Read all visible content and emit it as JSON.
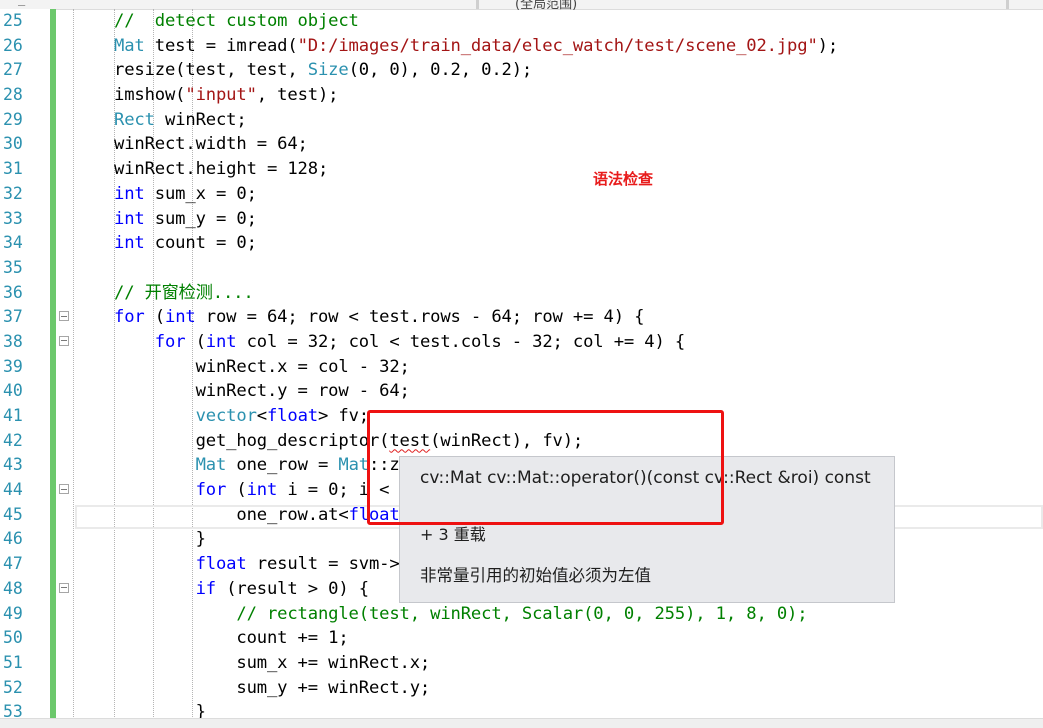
{
  "editor": {
    "lines": [
      {
        "num": "25",
        "html": "<span class=\"c\">//  detect custom object</span>"
      },
      {
        "num": "26",
        "html": "<span class=\"t\">Mat</span> test = imread(<span class=\"s\">\"D:/images/train_data/elec_watch/test/scene_02.jpg\"</span>);"
      },
      {
        "num": "27",
        "html": "resize(test, test, <span class=\"t\">Size</span>(0, 0), 0.2, 0.2);"
      },
      {
        "num": "28",
        "html": "imshow(<span class=\"s\">\"input\"</span>, test);"
      },
      {
        "num": "29",
        "html": "<span class=\"t\">Rect</span> winRect;"
      },
      {
        "num": "30",
        "html": "winRect.width = 64;"
      },
      {
        "num": "31",
        "html": "winRect.height = 128;"
      },
      {
        "num": "32",
        "html": "<span class=\"k\">int</span> sum_x = 0;"
      },
      {
        "num": "33",
        "html": "<span class=\"k\">int</span> sum_y = 0;"
      },
      {
        "num": "34",
        "html": "<span class=\"k\">int</span> count = 0;"
      },
      {
        "num": "35",
        "html": ""
      },
      {
        "num": "36",
        "html": "<span class=\"c\">// 开窗检测....</span>"
      },
      {
        "num": "37",
        "html": "<span class=\"k\">for</span> (<span class=\"k\">int</span> row = 64; row &lt; test.rows - 64; row += 4) {",
        "fold": true
      },
      {
        "num": "38",
        "html": "    <span class=\"k\">for</span> (<span class=\"k\">int</span> col = 32; col &lt; test.cols - 32; col += 4) {",
        "fold": true
      },
      {
        "num": "39",
        "html": "        winRect.x = col - 32;"
      },
      {
        "num": "40",
        "html": "        winRect.y = row - 64;"
      },
      {
        "num": "41",
        "html": "        <span class=\"t\">vector</span>&lt;<span class=\"k\">float</span>&gt; fv;"
      },
      {
        "num": "42",
        "html": "        get_hog_descriptor(<span class=\"squig\">test</span>(winRect), fv);"
      },
      {
        "num": "43",
        "html": "        <span class=\"t\">Mat</span> one_row = <span class=\"t\">Mat</span>::zeros"
      },
      {
        "num": "44",
        "html": "        <span class=\"k\">for</span> (<span class=\"k\">int</span> i = 0; i &lt; fv.",
        "fold": true
      },
      {
        "num": "45",
        "html": "            one_row.at&lt;<span class=\"k\">float</span>&gt;(0"
      },
      {
        "num": "46",
        "html": "        }"
      },
      {
        "num": "47",
        "html": "        <span class=\"k\">float</span> result = svm-&gt;pr"
      },
      {
        "num": "48",
        "html": "        <span class=\"k\">if</span> (result &gt; 0) {",
        "fold": true
      },
      {
        "num": "49",
        "html": "            <span class=\"c\">// rectangle(test, winRect, Scalar(0, 0, 255), 1, 8, 0);</span>"
      },
      {
        "num": "50",
        "html": "            count += 1;"
      },
      {
        "num": "51",
        "html": "            sum_x += winRect.x;"
      },
      {
        "num": "52",
        "html": "            sum_y += winRect.y;"
      },
      {
        "num": "53",
        "html": "        }"
      }
    ]
  },
  "annotation": {
    "label": "语法检查",
    "color": "#e81c1c"
  },
  "tooltip": {
    "signature": "cv::Mat cv::Mat::operator()(const cv::Rect &roi) const",
    "overloads": "+ 3 重载",
    "error": "非常量引用的初始值必须为左值"
  },
  "header": {
    "fragment": "(全局范围)"
  }
}
